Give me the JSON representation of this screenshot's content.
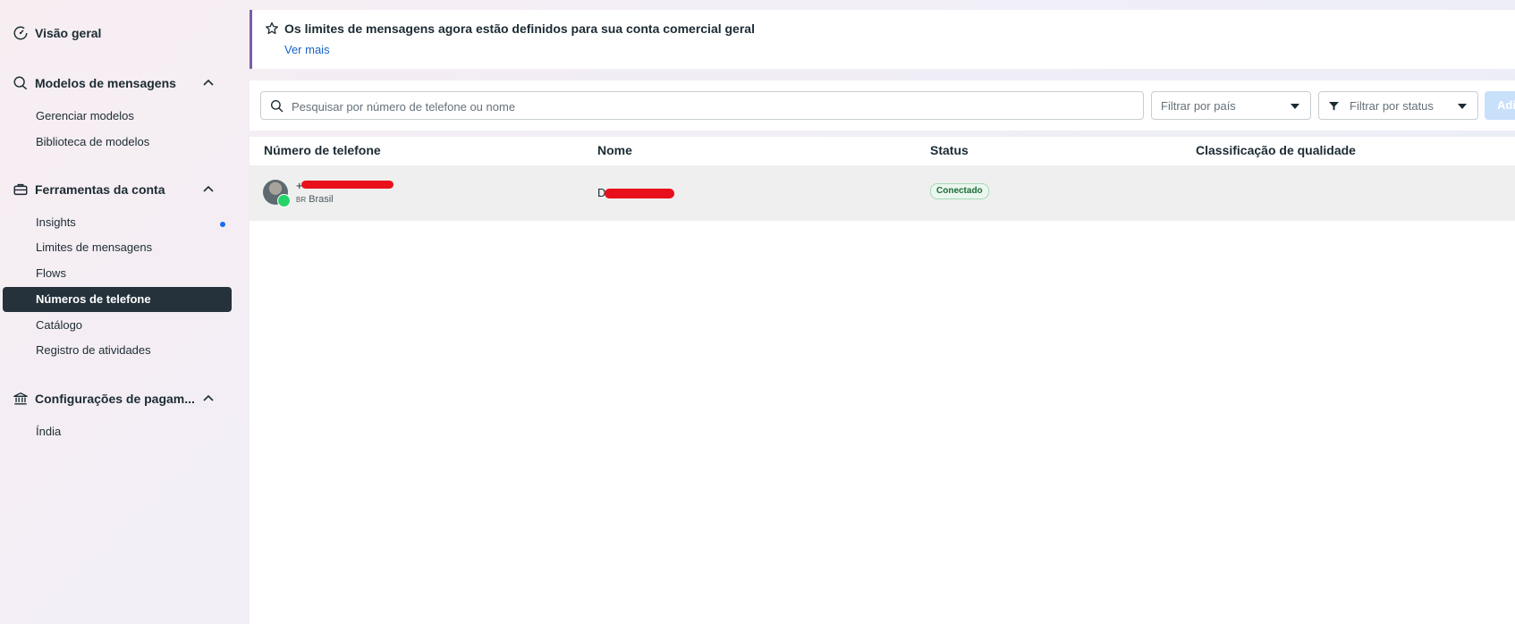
{
  "sidebar": {
    "overview": "Visão geral",
    "templates": {
      "label": "Modelos de mensagens",
      "items": [
        "Gerenciar modelos",
        "Biblioteca de modelos"
      ]
    },
    "account_tools": {
      "label": "Ferramentas da conta",
      "items": [
        "Insights",
        "Limites de mensagens",
        "Flows",
        "Números de telefone",
        "Catálogo",
        "Registro de atividades"
      ]
    },
    "payment": {
      "label": "Configurações de pagam...",
      "items": [
        "Índia"
      ]
    }
  },
  "banner": {
    "title": "Os limites de mensagens agora estão definidos para sua conta comercial geral",
    "link": "Ver mais"
  },
  "filters": {
    "search_placeholder": "Pesquisar por número de telefone ou nome",
    "country": "Filtrar por país",
    "status": "Filtrar por status",
    "add_button": "Adi"
  },
  "table": {
    "headers": [
      "Número de telefone",
      "Nome",
      "Status",
      "Classificação de qualidade"
    ],
    "rows": [
      {
        "phone": "+",
        "country_code": "BR",
        "country": "Brasil",
        "name": "D",
        "status": "Conectado"
      }
    ]
  },
  "colors": {
    "active_nav_bg": "#25323b",
    "link": "#1664cc",
    "banner_accent": "#7b5fa7",
    "redaction": "#e8101a",
    "status_green": "#1d6a36"
  }
}
